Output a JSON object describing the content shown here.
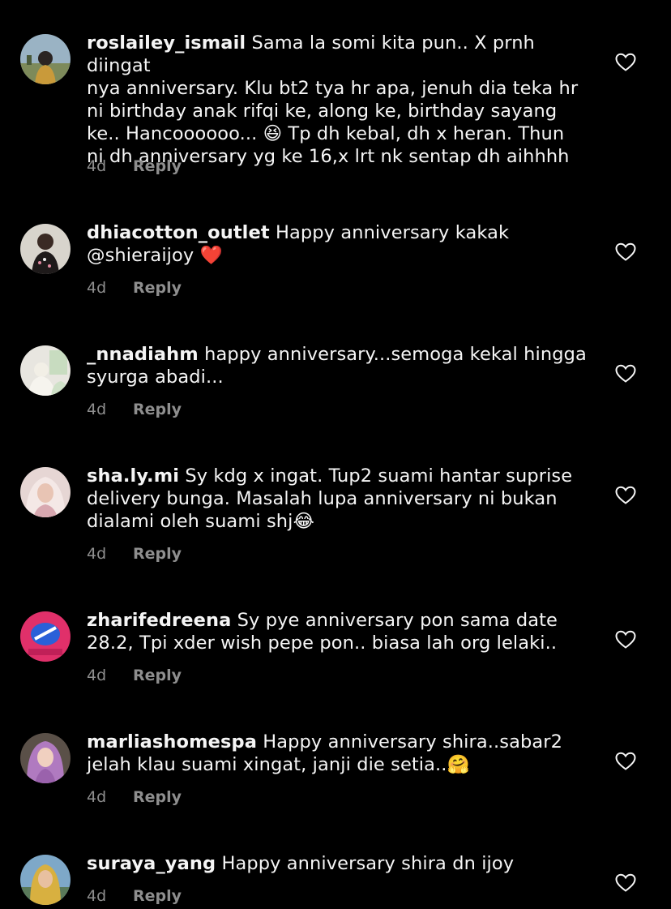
{
  "comments": [
    {
      "username": "roslailey_ismail",
      "text": "Sama la somi kita pun.. X prnh diingat\nnya anniversary. Klu bt2 tya hr apa, jenuh dia teka hr\nni birthday anak rifqi ke, along ke, birthday sayang\nke.. Hancoooooo... 😆 Tp dh kebal, dh x heran. Thun\nni dh anniversary yg ke 16,x lrt nk sentap dh aihhhh",
      "time": "4d",
      "reply": "Reply"
    },
    {
      "username": "dhiacotton_outlet",
      "text": "Happy anniversary kakak\n@shieraijoy ❤️",
      "time": "4d",
      "reply": "Reply"
    },
    {
      "username": "_nnadiahm",
      "text": "happy anniversary...semoga kekal hingga\nsyurga abadi...",
      "time": "4d",
      "reply": "Reply"
    },
    {
      "username": "sha.ly.mi",
      "text": "Sy kdg x ingat. Tup2 suami hantar suprise\ndelivery bunga. Masalah lupa anniversary ni bukan\ndialami oleh suami shj😂",
      "time": "4d",
      "reply": "Reply"
    },
    {
      "username": "zharifedreena",
      "text": "Sy pye anniversary pon sama date\n28.2, Tpi xder wish pepe pon.. biasa lah org lelaki..",
      "time": "4d",
      "reply": "Reply"
    },
    {
      "username": "marliashomespa",
      "text": "Happy anniversary shira..sabar2\njelah klau suami xingat, janji die setia..🤗",
      "time": "4d",
      "reply": "Reply"
    },
    {
      "username": "suraya_yang",
      "text": "Happy anniversary shira dn ijoy",
      "time": "4d",
      "reply": "Reply"
    }
  ],
  "colors": {
    "background": "#000000",
    "text": "#f5f5f5",
    "secondary": "#8e8e8e"
  },
  "icons": {
    "like": "heart-outline-icon"
  }
}
